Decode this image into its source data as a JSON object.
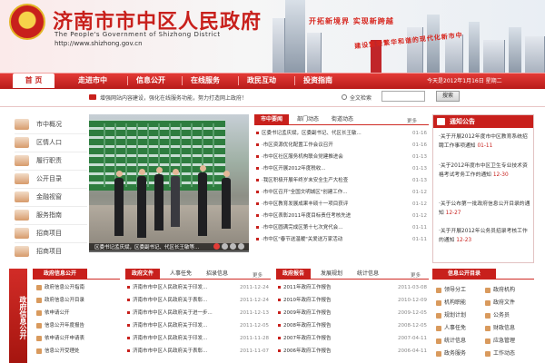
{
  "header": {
    "title_cn": "济南市市中区人民政府",
    "title_en": "The People's Government of Shizhong District",
    "url": "http://www.shizhong.gov.cn",
    "slogan_1": "开拓新境界 实现新跨越",
    "slogan_2": "建设繁荣繁华和谐的现代化新市中"
  },
  "nav": {
    "home": "首 页",
    "items": [
      "走进市中",
      "信息公开",
      "在线服务",
      "政民互动",
      "投资指南"
    ],
    "date": "今天是2012年1月16日 星期二"
  },
  "notice_bar": {
    "text": "增强网站内容建设，强化在线服务功能，努力打造网上政府！",
    "search_label": "全文检索",
    "search_placeholder": "",
    "search_button": "搜索"
  },
  "sidebar": {
    "items": [
      "市中概况",
      "区情人口",
      "履行职责",
      "公开目录",
      "金融视窗",
      "服务指南",
      "招商项目",
      "招商项目"
    ]
  },
  "photo": {
    "caption": "区委书记孟庆斌，区委副书记、代区长王敏等..."
  },
  "news": {
    "tabs": [
      "市中要闻",
      "部门动态",
      "街道动态"
    ],
    "more": "更多",
    "rows": [
      {
        "title": "区委书记孟庆斌，区委副书记、代区长王敏...",
        "date": "01-16"
      },
      {
        "title": "·市区资源优化配置工作会议召开",
        "date": "01-16"
      },
      {
        "title": "·市中区社区服务机构联合党建推进会",
        "date": "01-13"
      },
      {
        "title": "·市中区开展2012年度税收...",
        "date": "01-13"
      },
      {
        "title": "·我区积极开展年终岁末安全生产大检查",
        "date": "01-13"
      },
      {
        "title": "·市中区召开\"全国文明城区\"创建工作...",
        "date": "01-12"
      },
      {
        "title": "·市中区教育发展成果丰硕十一项目获评",
        "date": "01-12"
      },
      {
        "title": "·市中区表彰2011年度目标责任考核先进",
        "date": "01-12"
      },
      {
        "title": "·市中区圆满完成区第十七次党代会...",
        "date": "01-11"
      },
      {
        "title": "·市中区\"春节送温暖\"关爱送万家活动",
        "date": "01-11"
      }
    ]
  },
  "notice": {
    "title": "通知公告",
    "items": [
      {
        "text": "·关于开展2012年度市中区教育系统招聘工作事项通知",
        "date": "01-11"
      },
      {
        "text": "·关于2012年度市中区卫生专业技术资格考试考务工作的通知",
        "date": "12-30"
      },
      {
        "text": "·关于公布第一批政府信息公开目录的通知",
        "date": "12-27"
      },
      {
        "text": "·关于开展2012年公务员招录考核工作的通知",
        "date": "12-23"
      }
    ]
  },
  "bottom": {
    "vbanner": "政府信息公开",
    "left_title": "政府信息公开",
    "left_items": [
      "政府信息公开指南",
      "政府信息公开目录",
      "依申请公开",
      "信息公开年度报告",
      "依申请公开申请表",
      "信息公开受理处"
    ],
    "mid1_title": "政府文件",
    "mid1_tabs": [
      "人事任免",
      "招录信息"
    ],
    "more": "更多",
    "mid1_rows": [
      {
        "title": "济南市市中区人民政府关于印发...",
        "date": "2011-12-24"
      },
      {
        "title": "济南市市中区人民政府关于表彰...",
        "date": "2011-12-24"
      },
      {
        "title": "济南市市中区人民政府关于进一步...",
        "date": "2011-12-13"
      },
      {
        "title": "济南市市中区人民政府关于印发...",
        "date": "2011-12-05"
      },
      {
        "title": "济南市市中区人民政府关于印发...",
        "date": "2011-11-28"
      },
      {
        "title": "济南市市中区人民政府关于表彰...",
        "date": "2011-11-07"
      }
    ],
    "mid2_title": "政府报告",
    "mid2_tabs": [
      "发展规划",
      "统计信息"
    ],
    "mid2_rows": [
      {
        "title": "2011年政府工作报告",
        "date": "2011-03-08"
      },
      {
        "title": "2010年政府工作报告",
        "date": "2010-12-09"
      },
      {
        "title": "2009年政府工作报告",
        "date": "2009-12-05"
      },
      {
        "title": "2008年政府工作报告",
        "date": "2008-12-05"
      },
      {
        "title": "2007年政府工作报告",
        "date": "2007-04-11"
      },
      {
        "title": "2006年政府工作报告",
        "date": "2006-04-11"
      }
    ],
    "right_title": "信息公开目录",
    "right_grid": [
      "领导分工",
      "政府机构",
      "机构职能",
      "政府文件",
      "规划计划",
      "公务员",
      "人事任免",
      "财政信息",
      "统计信息",
      "应急管理",
      "政务服务",
      "工作动态"
    ]
  },
  "colors": {
    "brand_red": "#c8201c"
  }
}
